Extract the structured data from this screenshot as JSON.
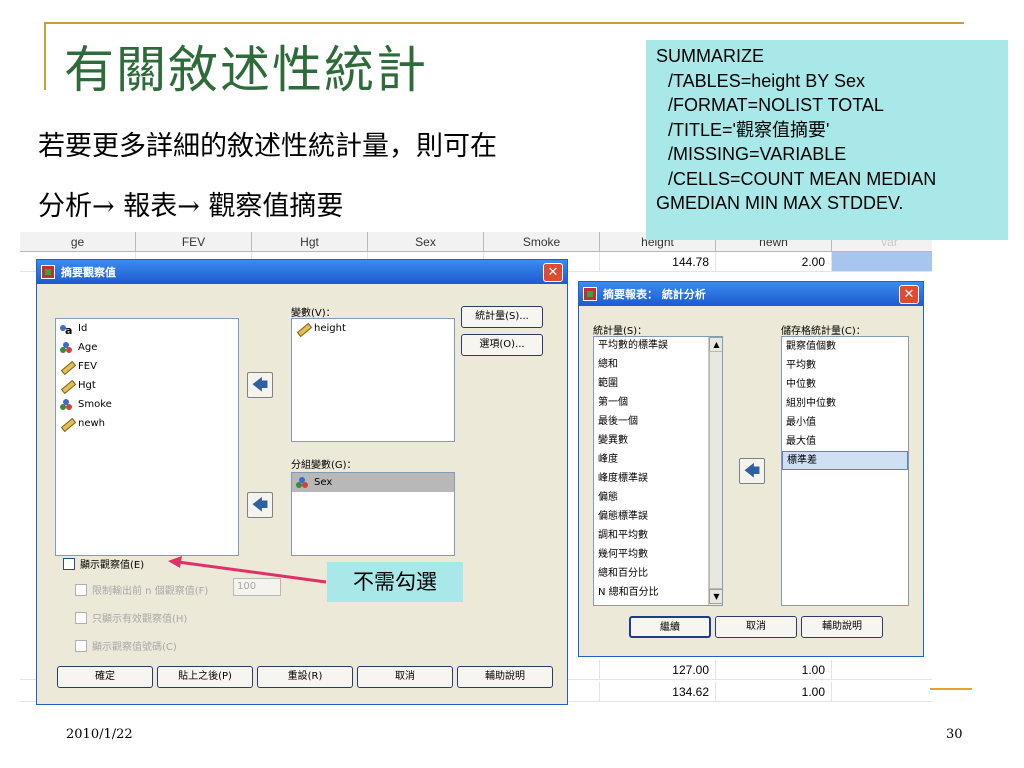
{
  "slide": {
    "title": "有關敘述性統計",
    "line1": "若要更多詳細的敘述性統計量，則可在",
    "line2": "分析→ 報表→ 觀察值摘要",
    "footer_date": "2010/1/22",
    "page_number": "30",
    "annotation": "不需勾選"
  },
  "syntax_box": {
    "lines": [
      "SUMMARIZE",
      "/TABLES=height BY Sex",
      "/FORMAT=NOLIST TOTAL",
      "/TITLE='觀察值摘要'",
      "/MISSING=VARIABLE",
      "/CELLS=COUNT MEAN MEDIAN",
      "GMEDIAN MIN MAX STDDEV."
    ]
  },
  "data_grid": {
    "headers": [
      "ge",
      "FEV",
      "Hgt",
      "Sex",
      "Smoke",
      "height",
      "newh",
      "var",
      "var"
    ],
    "rows": [
      [
        "",
        "",
        "",
        "",
        "",
        "144.78",
        "2.00",
        "",
        ""
      ],
      [
        "",
        "",
        "",
        "",
        "",
        "127.00",
        "1.00",
        "",
        ""
      ],
      [
        "",
        "",
        "",
        "",
        "",
        "134.62",
        "1.00",
        "",
        ""
      ]
    ]
  },
  "summarize_dialog": {
    "title": "摘要觀察值",
    "variables_label": "變數(V)：",
    "grouping_label": "分組變數(G)：",
    "source_list": [
      {
        "name": "Id",
        "icon": "id-icon"
      },
      {
        "name": "Age",
        "icon": "nominal-icon"
      },
      {
        "name": "FEV",
        "icon": "scale-icon"
      },
      {
        "name": "Hgt",
        "icon": "scale-icon"
      },
      {
        "name": "Smoke",
        "icon": "nominal-icon"
      },
      {
        "name": "newh",
        "icon": "scale-icon"
      }
    ],
    "selected_variables": [
      "height"
    ],
    "grouping_variables": [
      "Sex"
    ],
    "statistics_button": "統計量(S)...",
    "options_button": "選項(O)...",
    "display_cases": "顯示觀察值(E)",
    "limit_cases": "限制輸出前 n 個觀察值(F)",
    "limit_value": "100",
    "valid_only": "只顯示有效觀察值(H)",
    "case_numbers": "顯示觀察值號碼(C)",
    "buttons": {
      "ok": "確定",
      "paste": "貼上之後(P)",
      "reset": "重設(R)",
      "cancel": "取消",
      "help": "輔助說明"
    }
  },
  "statistics_dialog": {
    "title": "摘要報表： 統計分析",
    "statistics_label": "統計量(S)：",
    "cell_stats_label": "儲存格統計量(C)：",
    "statistics": [
      "平均數的標準誤",
      "總和",
      "範圍",
      "第一個",
      "最後一個",
      "變異數",
      "峰度",
      "峰度標準誤",
      "偏態",
      "偏態標準誤",
      "調和平均數",
      "幾何平均數",
      "總和百分比",
      "N 總和百分比"
    ],
    "cell_statistics": [
      "觀察值個數",
      "平均數",
      "中位數",
      "組別中位數",
      "最小值",
      "最大值",
      "標準差"
    ],
    "selected_cell_statistic": "標準差",
    "buttons": {
      "continue": "繼續",
      "cancel": "取消",
      "help": "輔助說明"
    }
  },
  "colors": {
    "title_green": "#2f6b3a",
    "annotation_bg": "#a8e8e8",
    "titlebar_blue": "#1d5ad0",
    "pointer_red": "#e0306a"
  }
}
